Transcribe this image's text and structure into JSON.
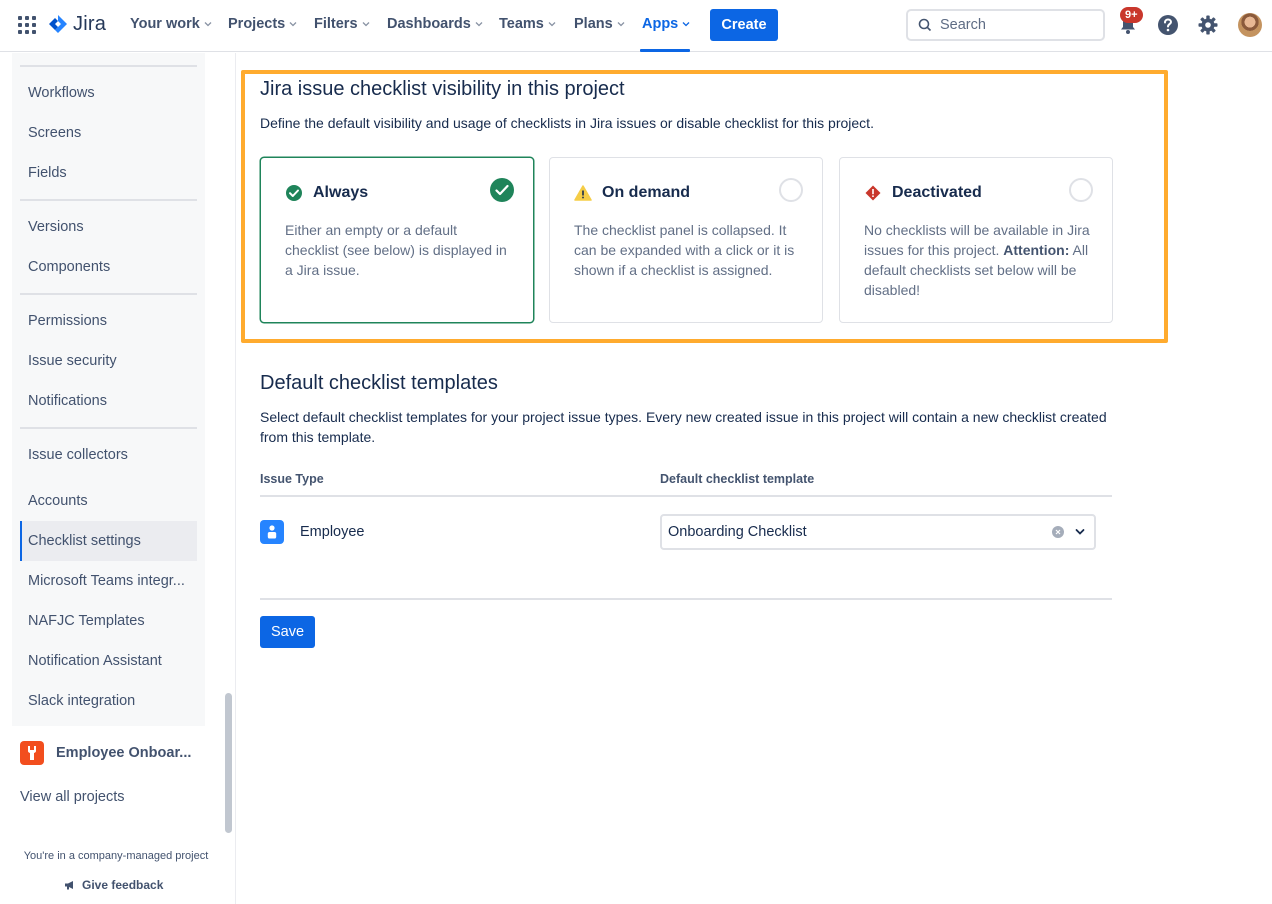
{
  "topnav": {
    "logo_text": "Jira",
    "items": [
      {
        "label": "Your work"
      },
      {
        "label": "Projects"
      },
      {
        "label": "Filters"
      },
      {
        "label": "Dashboards"
      },
      {
        "label": "Teams"
      },
      {
        "label": "Plans"
      },
      {
        "label": "Apps",
        "active": true
      }
    ],
    "create_label": "Create",
    "search_placeholder": "Search",
    "notification_count": "9+",
    "accent_color": "#0c66e4"
  },
  "sidebar": {
    "items": [
      {
        "label": "Workflows"
      },
      {
        "label": "Screens"
      },
      {
        "label": "Fields"
      },
      {
        "label": "Versions"
      },
      {
        "label": "Components"
      },
      {
        "label": "Permissions"
      },
      {
        "label": "Issue security"
      },
      {
        "label": "Notifications"
      },
      {
        "label": "Issue collectors"
      },
      {
        "label": "Accounts"
      },
      {
        "label": "Checklist settings",
        "selected": true
      },
      {
        "label": "Microsoft Teams integr..."
      },
      {
        "label": "NAFJC Templates"
      },
      {
        "label": "Notification Assistant"
      },
      {
        "label": "Slack integration"
      }
    ],
    "project_name": "Employee Onboar...",
    "view_all": "View all projects",
    "company_note": "You're in a company-managed project",
    "feedback": "Give feedback"
  },
  "visibility": {
    "title": "Jira issue checklist visibility in this project",
    "description": "Define the default visibility and usage of checklists in Jira issues or disable checklist for this project.",
    "options": [
      {
        "title": "Always",
        "icon": "check-circle-icon",
        "body": "Either an empty or a default checklist (see below) is displayed in a Jira issue.",
        "selected": true
      },
      {
        "title": "On demand",
        "icon": "warning-icon",
        "body": "The checklist panel is collapsed. It can be expanded with a click or it is shown if a checklist is assigned.",
        "selected": false
      },
      {
        "title": "Deactivated",
        "icon": "error-diamond-icon",
        "body": "No checklists will be available in Jira issues for this project.",
        "attention_label": "Attention:",
        "attention_text": " All default checklists set below will be disabled!",
        "selected": false
      }
    ],
    "highlight_color": "#ffab2e"
  },
  "templates": {
    "title": "Default checklist templates",
    "description": "Select default checklist templates for your project issue types. Every new created issue in this project will contain a new checklist created from this template.",
    "col_issue_type": "Issue Type",
    "col_template": "Default checklist template",
    "rows": [
      {
        "issue_type": "Employee",
        "template": "Onboarding Checklist"
      }
    ],
    "save_label": "Save"
  }
}
